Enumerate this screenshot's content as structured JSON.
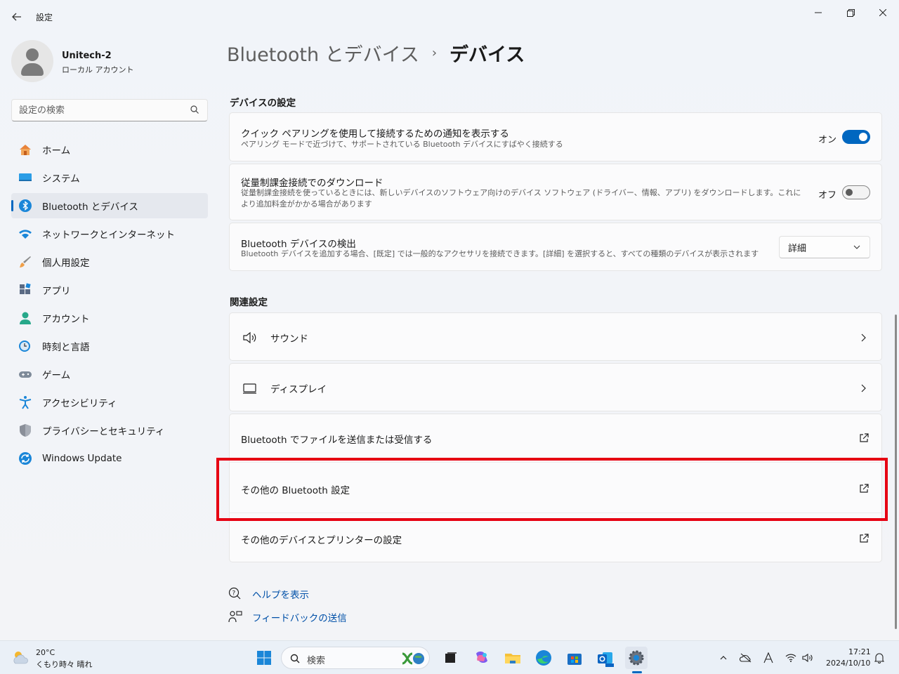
{
  "window": {
    "app_title": "設定",
    "controls": {
      "minimize": "—",
      "maximize": "▢",
      "close": "✕"
    }
  },
  "user": {
    "name": "Unitech-2",
    "account_type": "ローカル アカウント"
  },
  "search": {
    "placeholder": "設定の検索"
  },
  "sidebar": {
    "items": [
      {
        "label": "ホーム",
        "icon": "home-icon"
      },
      {
        "label": "システム",
        "icon": "system-icon"
      },
      {
        "label": "Bluetooth とデバイス",
        "icon": "bluetooth-icon",
        "active": true
      },
      {
        "label": "ネットワークとインターネット",
        "icon": "wifi-icon"
      },
      {
        "label": "個人用設定",
        "icon": "brush-icon"
      },
      {
        "label": "アプリ",
        "icon": "apps-icon"
      },
      {
        "label": "アカウント",
        "icon": "account-icon"
      },
      {
        "label": "時刻と言語",
        "icon": "time-language-icon"
      },
      {
        "label": "ゲーム",
        "icon": "gamepad-icon"
      },
      {
        "label": "アクセシビリティ",
        "icon": "accessibility-icon"
      },
      {
        "label": "プライバシーとセキュリティ",
        "icon": "shield-icon"
      },
      {
        "label": "Windows Update",
        "icon": "update-icon"
      }
    ]
  },
  "breadcrumb": {
    "parent": "Bluetooth とデバイス",
    "separator": "›",
    "current": "デバイス"
  },
  "device_settings": {
    "heading": "デバイスの設定",
    "swift_pair": {
      "title": "クイック ペアリングを使用して接続するための通知を表示する",
      "desc": "ペアリング モードで近づけて、サポートされている Bluetooth デバイスにすばやく接続する",
      "state_label": "オン",
      "enabled": true
    },
    "metered_download": {
      "title": "従量制課金接続でのダウンロード",
      "desc": "従量制課金接続を使っているときには、新しいデバイスのソフトウェア向けのデバイス ソフトウェア (ドライバー、情報、アプリ) をダウンロードします。これにより追加料金がかかる場合があります",
      "state_label": "オフ",
      "enabled": false
    },
    "discovery": {
      "title": "Bluetooth デバイスの検出",
      "desc": "Bluetooth デバイスを追加する場合、[既定] では一般的なアクセサリを接続できます。[詳細] を選択すると、すべての種類のデバイスが表示されます",
      "selected": "詳細"
    }
  },
  "related": {
    "heading": "関連設定",
    "sound": "サウンド",
    "display": "ディスプレイ",
    "send_receive": "Bluetooth でファイルを送信または受信する",
    "more_bluetooth": "その他の Bluetooth 設定",
    "devices_printers": "その他のデバイスとプリンターの設定"
  },
  "help": {
    "get_help": "ヘルプを表示",
    "feedback": "フィードバックの送信"
  },
  "colors": {
    "accent": "#0067c0",
    "highlight": "#e60012"
  },
  "taskbar": {
    "weather": {
      "temp": "20°C",
      "condition": "くもり時々 晴れ"
    },
    "search_label": "検索",
    "time": "17:21",
    "date": "2024/10/10"
  }
}
